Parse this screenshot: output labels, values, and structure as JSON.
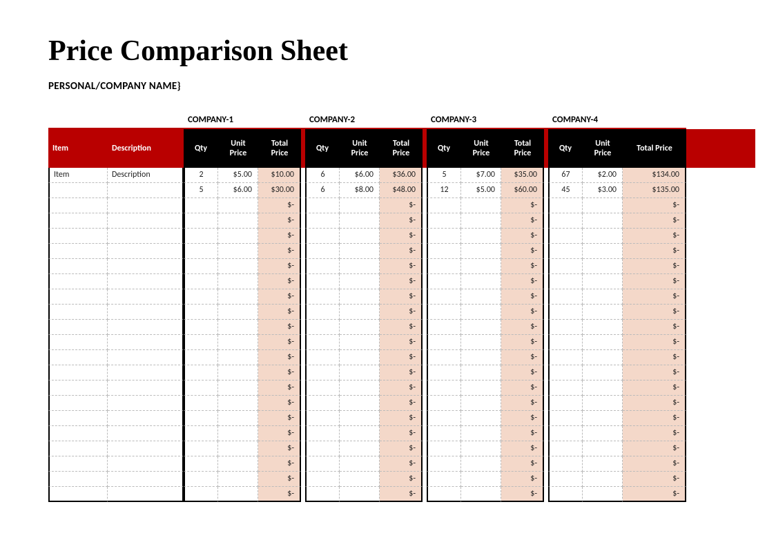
{
  "title": "Price Comparison Sheet",
  "subtitle": "PERSONAL/COMPANY NAME}",
  "companies": [
    "COMPANY-1",
    "COMPANY-2",
    "COMPANY-3",
    "COMPANY-4"
  ],
  "headers": {
    "item": "Item",
    "description": "Description",
    "qty": "Qty",
    "unit_price": "Unit Price",
    "total_price": "Total Price"
  },
  "empty_total": "$-",
  "row_count": 22,
  "rows": [
    {
      "item": "Item",
      "description": "Description",
      "c": [
        {
          "qty": "2",
          "unit": "$5.00",
          "total": "$10.00"
        },
        {
          "qty": "6",
          "unit": "$6.00",
          "total": "$36.00"
        },
        {
          "qty": "5",
          "unit": "$7.00",
          "total": "$35.00"
        },
        {
          "qty": "67",
          "unit": "$2.00",
          "total": "$134.00"
        }
      ]
    },
    {
      "item": "",
      "description": "",
      "c": [
        {
          "qty": "5",
          "unit": "$6.00",
          "total": "$30.00"
        },
        {
          "qty": "6",
          "unit": "$8.00",
          "total": "$48.00"
        },
        {
          "qty": "12",
          "unit": "$5.00",
          "total": "$60.00"
        },
        {
          "qty": "45",
          "unit": "$3.00",
          "total": "$135.00"
        }
      ]
    }
  ]
}
